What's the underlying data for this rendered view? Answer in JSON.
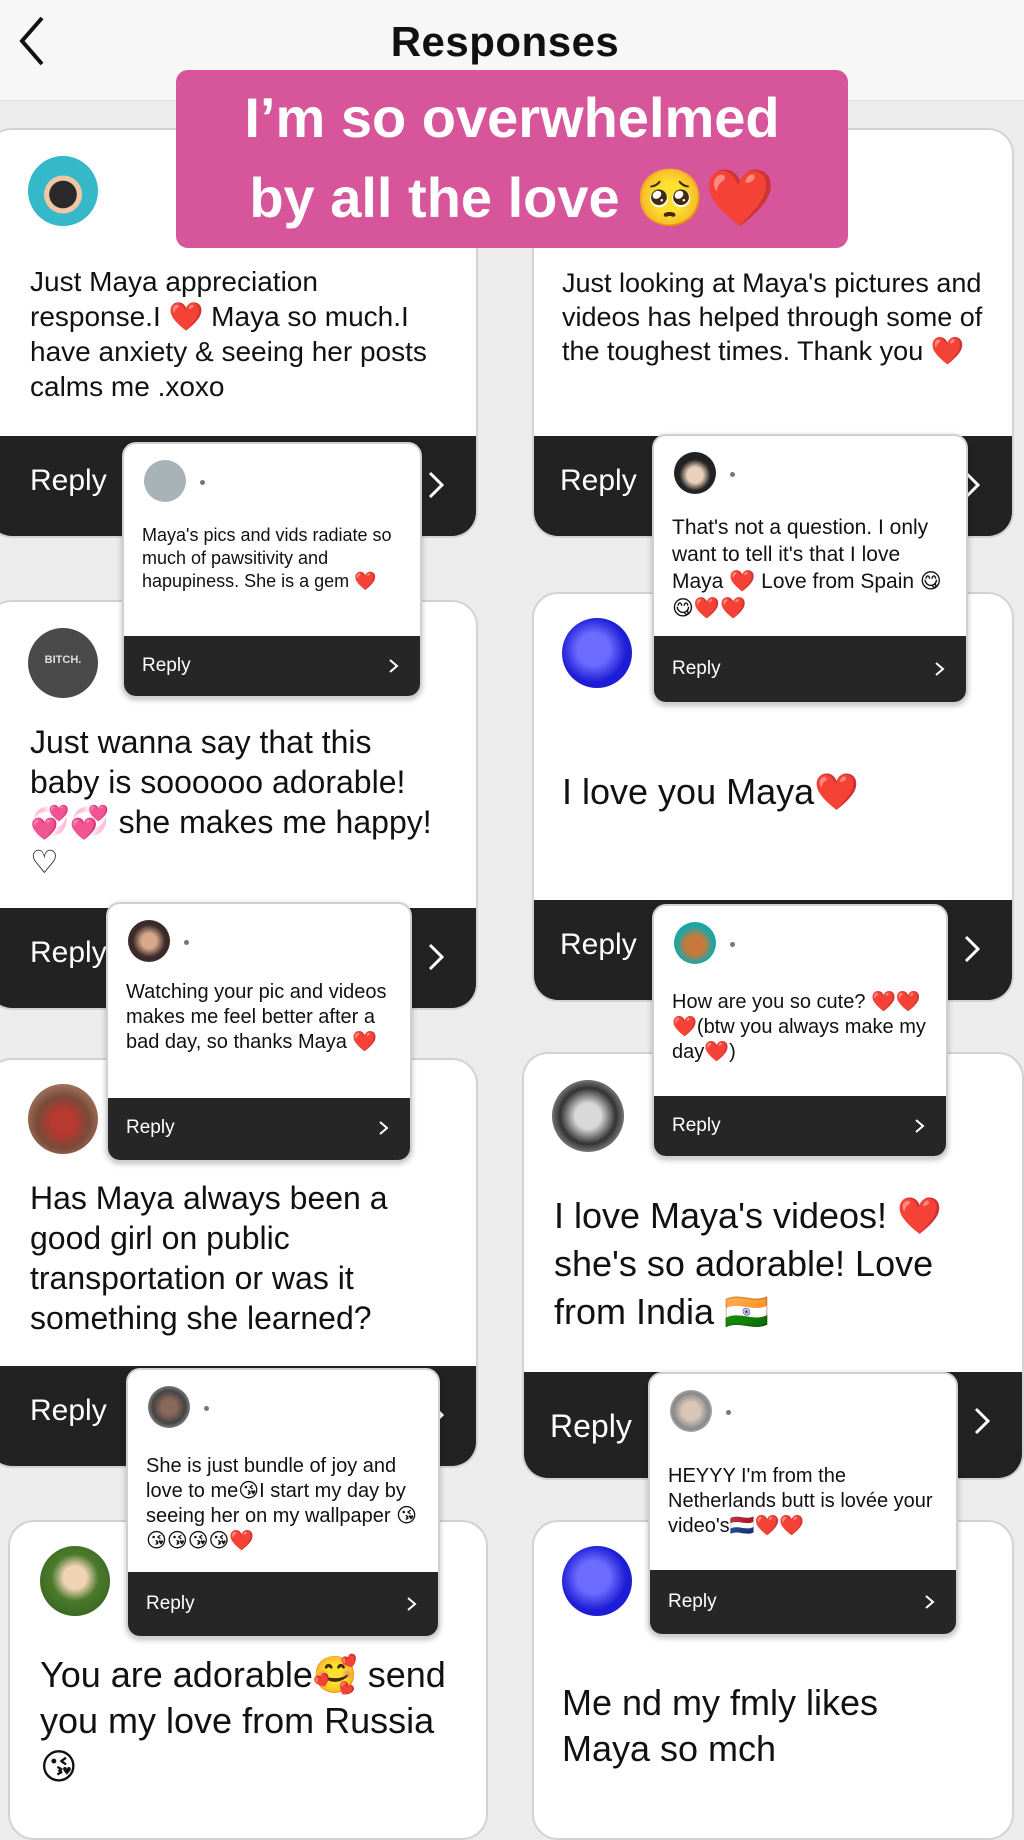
{
  "header": {
    "title": "Responses"
  },
  "banner": {
    "line1": "I’m so overwhelmed",
    "line2": "by all the love 🥺❤️",
    "color": "#d6559b"
  },
  "reply_label": "Reply",
  "cards": [
    {
      "text": "Just Maya appreciation response.I ❤️ Maya so much.I have anxiety & seeing her posts calms me .xoxo"
    },
    {
      "text": "Just looking at Maya's pictures and videos has helped through some of the toughest times. Thank you ❤️"
    },
    {
      "text": "Just wanna say that this baby is soooooo adorable! 💞💞 she makes me happy!♡",
      "avatar_text": "BITCH."
    },
    {
      "text": "I love you Maya❤️"
    },
    {
      "text": "Has Maya always been a good girl on public transportation or was it something she learned?"
    },
    {
      "text": "I love Maya's videos! ❤️ she's so adorable! Love from India 🇮🇳"
    },
    {
      "text": "You are adorable🥰 send you my love from Russia😘"
    },
    {
      "text": "Me nd my fmly likes Maya so mch"
    }
  ],
  "minis": [
    {
      "text": "Maya's pics and vids radiate so much of pawsitivity and hapupiness. She is a gem ❤️"
    },
    {
      "text": "That's not a question. I only want to tell it's that I love Maya ❤️ Love from Spain 😋😋❤️❤️"
    },
    {
      "text": "Watching your pic and videos makes me feel better after a bad day, so thanks Maya ❤️"
    },
    {
      "text": "How are you so cute? ❤️❤️❤️(btw you always make my day❤️)"
    },
    {
      "text": "She is just bundle of joy and love to me😘I start my day by seeing her on my wallpaper 😘😘😘😘😘❤️"
    },
    {
      "text": "HEYYY I'm from the Netherlands butt is lovée your video's🇳🇱❤️❤️"
    }
  ]
}
